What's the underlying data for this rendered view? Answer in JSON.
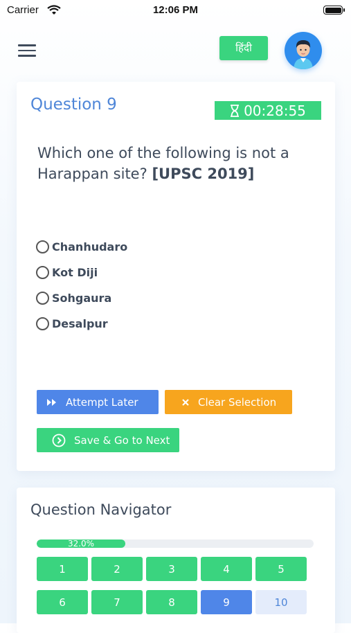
{
  "status_bar": {
    "carrier": "Carrier",
    "time": "12:06 PM"
  },
  "header": {
    "language_button": "हिंदी"
  },
  "question": {
    "title": "Question 9",
    "timer": "00:28:55",
    "text": "Which one of the following is not a Harappan site?",
    "tag": "[UPSC 2019]",
    "options": [
      "Chanhudaro",
      "Kot Diji",
      "Sohgaura",
      "Desalpur"
    ]
  },
  "actions": {
    "attempt_later": "Attempt Later",
    "clear_selection": "Clear Selection",
    "save_next": "Save & Go to Next"
  },
  "navigator": {
    "title": "Question Navigator",
    "progress_label": "32.0%",
    "progress_fraction": 0.32,
    "questions": [
      "1",
      "2",
      "3",
      "4",
      "5",
      "6",
      "7",
      "8",
      "9",
      "10"
    ],
    "current": "9",
    "pending": [
      "10"
    ]
  },
  "colors": {
    "green": "#3ad47f",
    "blue": "#4f86e8",
    "orange": "#f7a51e",
    "title_blue": "#4f86d8"
  }
}
